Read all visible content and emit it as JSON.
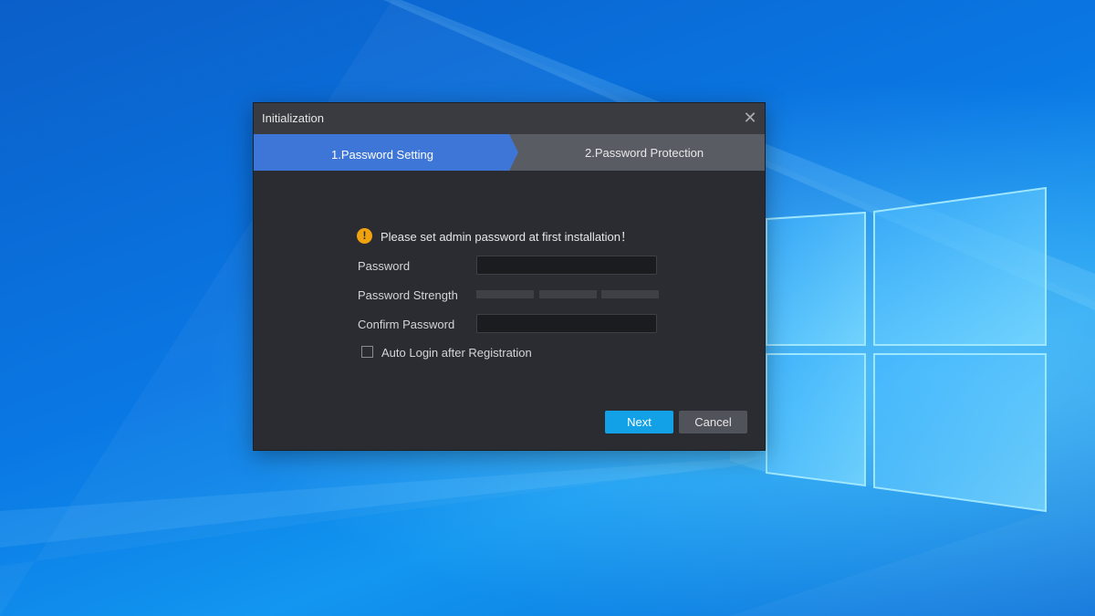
{
  "dialog": {
    "title": "Initialization",
    "close_icon": "close-icon"
  },
  "steps": [
    {
      "label": "1.Password Setting",
      "active": true
    },
    {
      "label": "2.Password Protection",
      "active": false
    }
  ],
  "form": {
    "notice": "Please set admin password at first installation！",
    "notice_icon": "warning-icon",
    "password_label": "Password",
    "password_value": "",
    "strength_label": "Password Strength",
    "strength_level": 0,
    "confirm_label": "Confirm Password",
    "confirm_value": "",
    "auto_login_label": "Auto Login after Registration",
    "auto_login_checked": false
  },
  "buttons": {
    "next": "Next",
    "cancel": "Cancel"
  },
  "colors": {
    "active_step": "#3d76d6",
    "next_button": "#12a1e6",
    "warning": "#f1a20f"
  }
}
